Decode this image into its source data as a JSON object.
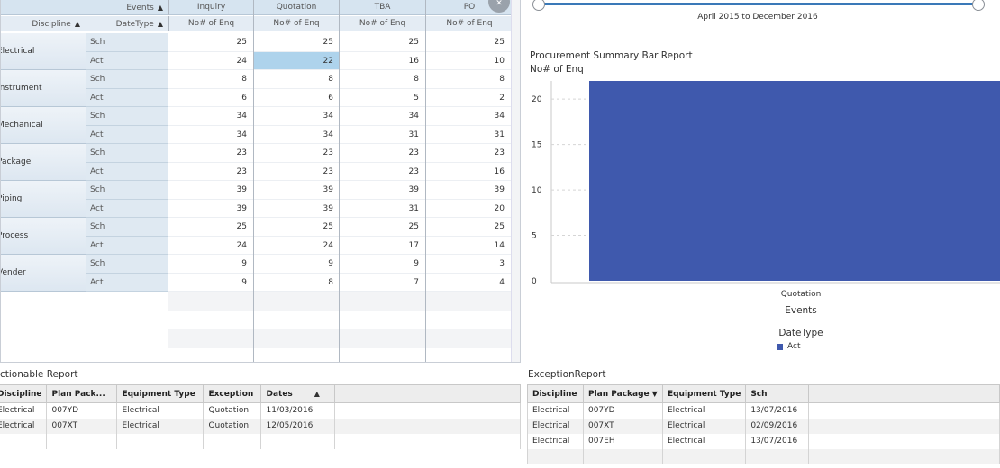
{
  "crosstab": {
    "events_label": "Events",
    "columns": [
      "Inquiry",
      "Quotation",
      "TBA",
      "PO"
    ],
    "discipline_header": "Discipline",
    "datetype_header": "DateType",
    "measure_label": "No# of Enq",
    "groups": [
      {
        "name": "Electrical",
        "rows": [
          {
            "type": "Sch",
            "values": [
              "25",
              "25",
              "25",
              "25"
            ]
          },
          {
            "type": "Act",
            "values": [
              "24",
              "22",
              "16",
              "10"
            ]
          }
        ]
      },
      {
        "name": "Instrument",
        "rows": [
          {
            "type": "Sch",
            "values": [
              "8",
              "8",
              "8",
              "8"
            ]
          },
          {
            "type": "Act",
            "values": [
              "6",
              "6",
              "5",
              "2"
            ]
          }
        ]
      },
      {
        "name": "Mechanical",
        "rows": [
          {
            "type": "Sch",
            "values": [
              "34",
              "34",
              "34",
              "34"
            ]
          },
          {
            "type": "Act",
            "values": [
              "34",
              "34",
              "31",
              "31"
            ]
          }
        ]
      },
      {
        "name": "Package",
        "rows": [
          {
            "type": "Sch",
            "values": [
              "23",
              "23",
              "23",
              "23"
            ]
          },
          {
            "type": "Act",
            "values": [
              "23",
              "23",
              "23",
              "16"
            ]
          }
        ]
      },
      {
        "name": "Piping",
        "rows": [
          {
            "type": "Sch",
            "values": [
              "39",
              "39",
              "39",
              "39"
            ]
          },
          {
            "type": "Act",
            "values": [
              "39",
              "39",
              "31",
              "20"
            ]
          }
        ]
      },
      {
        "name": "Process",
        "rows": [
          {
            "type": "Sch",
            "values": [
              "25",
              "25",
              "25",
              "25"
            ]
          },
          {
            "type": "Act",
            "values": [
              "24",
              "24",
              "17",
              "14"
            ]
          }
        ]
      },
      {
        "name": "Vender",
        "rows": [
          {
            "type": "Sch",
            "values": [
              "9",
              "9",
              "9",
              "3"
            ]
          },
          {
            "type": "Act",
            "values": [
              "9",
              "8",
              "7",
              "4"
            ]
          }
        ]
      }
    ]
  },
  "slider": {
    "range_text": "April 2015 to December 2016"
  },
  "chart_data": {
    "type": "bar",
    "title": "Procurement Summary Bar Report",
    "ylabel": "No# of Enq",
    "xlabel": "Events",
    "categories": [
      "Quotation"
    ],
    "series": [
      {
        "name": "Act",
        "values": [
          22
        ]
      }
    ],
    "ylim": [
      0,
      22
    ],
    "yticks": [
      0,
      5,
      10,
      15,
      20
    ],
    "grid": true,
    "legend_title": "DateType",
    "legend_position": "bottom",
    "bar_color": "#3f59ad"
  },
  "actionable": {
    "title": "ctionable Report",
    "headers": [
      "Discipline",
      "Plan Pack...",
      "Equipment Type",
      "Exception",
      "Dates"
    ],
    "rows": [
      [
        "Electrical",
        "007YD",
        "Electrical",
        "Quotation",
        "11/03/2016"
      ],
      [
        "Electrical",
        "007XT",
        "Electrical",
        "Quotation",
        "12/05/2016"
      ]
    ]
  },
  "exception": {
    "title": "ExceptionReport",
    "headers": [
      "Discipline",
      "Plan Package",
      "Equipment Type",
      "Sch"
    ],
    "rows": [
      [
        "Electrical",
        "007YD",
        "Electrical",
        "13/07/2016"
      ],
      [
        "Electrical",
        "007XT",
        "Electrical",
        "02/09/2016"
      ],
      [
        "Electrical",
        "007EH",
        "Electrical",
        "13/07/2016"
      ]
    ]
  }
}
